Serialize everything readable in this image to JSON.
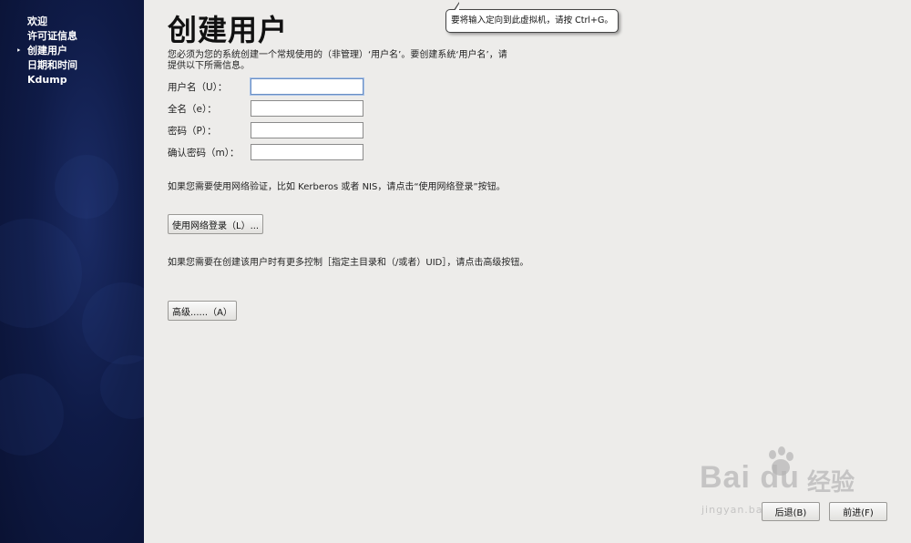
{
  "sidebar": {
    "items": [
      {
        "label": "欢迎",
        "current": false
      },
      {
        "label": "许可证信息",
        "current": false
      },
      {
        "label": "创建用户",
        "current": true
      },
      {
        "label": "日期和时间",
        "current": false
      },
      {
        "label": "Kdump",
        "current": false
      }
    ],
    "current_marker": "‣"
  },
  "main": {
    "title": "创建用户",
    "intro": "您必须为您的系统创建一个常规使用的（非管理）‘用户名’。要创建系统‘用户名’，请提供以下所需信息。",
    "fields": [
      {
        "label": "用户名（U）：",
        "value": ""
      },
      {
        "label": "全名（e）：",
        "value": ""
      },
      {
        "label": "密码（P）：",
        "value": ""
      },
      {
        "label": "确认密码（m）：",
        "value": ""
      }
    ],
    "network_text": "如果您需要使用网络验证，比如 Kerberos 或者 NIS，请点击“使用网络登录”按钮。",
    "network_button": "使用网络登录（L）...",
    "advanced_text": "如果您需要在创建该用户时有更多控制［指定主目录和（/或者）UID］，请点击高级按钮。",
    "advanced_button": "高级......（A）"
  },
  "footer": {
    "back_button": "后退(B)",
    "forward_button": "前进(F)"
  },
  "tooltip": {
    "text": "要将输入定向到此虚拟机，请按 Ctrl+G。"
  },
  "watermark": {
    "logo": "Bai du",
    "cn": "经验",
    "url": "jingyan.baidu.com"
  },
  "colors": {
    "sidebar_bg": "#0f1b47",
    "main_bg": "#edecea",
    "focus_border": "#6b8fc4"
  }
}
